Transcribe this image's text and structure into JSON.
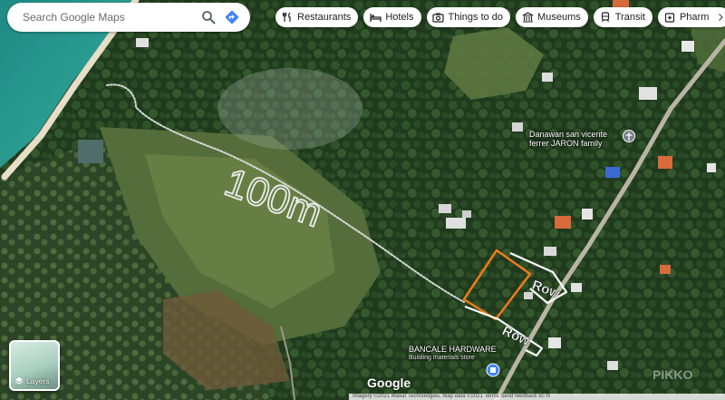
{
  "search": {
    "placeholder": "Search Google Maps"
  },
  "chips": [
    {
      "label": "Restaurants",
      "icon": "fork-knife-icon"
    },
    {
      "label": "Hotels",
      "icon": "bed-icon"
    },
    {
      "label": "Things to do",
      "icon": "camera-icon"
    },
    {
      "label": "Museums",
      "icon": "museum-icon"
    },
    {
      "label": "Transit",
      "icon": "train-icon"
    },
    {
      "label": "Pharm",
      "icon": "pharmacy-icon"
    }
  ],
  "places": {
    "church": {
      "line1": "Danawan san vicente",
      "line2": "ferrer JARON family"
    },
    "hardware": {
      "name": "BANCALE HARDWARE",
      "category": "Building materials store"
    }
  },
  "annotations": {
    "distance": "100m",
    "row1": "Row",
    "row2": "Row"
  },
  "layers_label": "Layers",
  "logo": "Google",
  "attribution": "Imagery ©2021 Maxar Technologies, Map data ©2021 Terms Send feedback 50 m",
  "watermark": "PIKKO",
  "colors": {
    "parcel_outline": "#f07a1a",
    "primary_blue": "#4285f4",
    "search_icon_gray": "#5f6368"
  }
}
